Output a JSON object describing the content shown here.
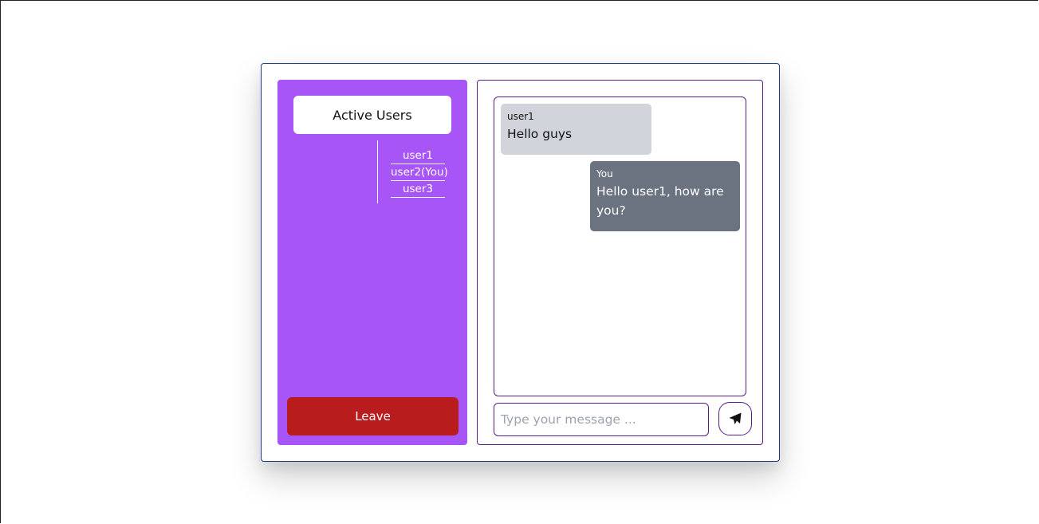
{
  "sidebar": {
    "title": "Active Users",
    "users": [
      "user1",
      "user2(You)",
      "user3"
    ],
    "leave_label": "Leave"
  },
  "messages": [
    {
      "sender": "user1",
      "text": "Hello guys",
      "direction": "incoming"
    },
    {
      "sender": "You",
      "text": "Hello user1, how are you?",
      "direction": "outgoing"
    }
  ],
  "composer": {
    "placeholder": "Type your message ...",
    "value": "",
    "send_icon": "paper-plane-icon"
  },
  "colors": {
    "sidebar_bg": "#a855f7",
    "leave_bg": "#b91c1c",
    "incoming_bg": "#d1d5db",
    "outgoing_bg": "#6b7280",
    "panel_border": "#581c87",
    "card_border": "#1e3a8a"
  }
}
